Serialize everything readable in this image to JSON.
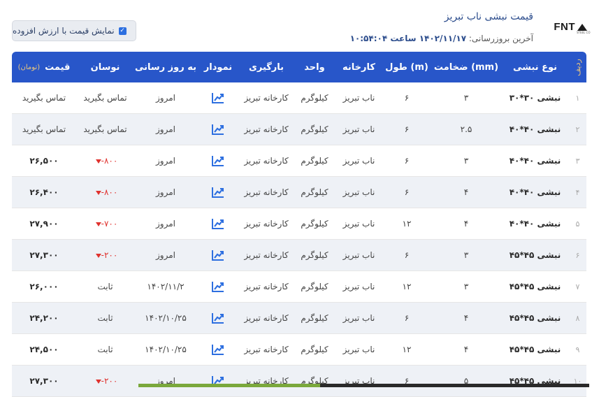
{
  "header": {
    "title": "قیمت نبشی ناب تبریز",
    "updated_label": "آخرین بروزرسانی:",
    "updated_value": "۱۴۰۲/۱۱/۱۷ ساعت ۱۰:۵۴:۰۴",
    "logo_text": "FNT",
    "logo_sub": "STEEL CO",
    "vat_label": "نمایش قیمت با ارزش افزوده",
    "vat_checked": true
  },
  "columns": {
    "radif": "ردیف",
    "type": "نوع نبشی",
    "thickness": "ضخامت (mm)",
    "length": "طول (m)",
    "factory": "کارخانه",
    "unit": "واحد",
    "loading": "بارگیری",
    "chart": "نمودار",
    "updated": "به روز رسانی",
    "fluctuation": "نوسان",
    "price": "قیمت",
    "price_unit": "(تومان)"
  },
  "rows": [
    {
      "idx": "۱",
      "type": "نبشی ۳۰*۳۰",
      "thickness": "۳",
      "length": "۶",
      "factory": "ناب تبریز",
      "unit": "کیلوگرم",
      "loading": "کارخانه تبریز",
      "updated": "امروز",
      "fluctuation": "تماس بگیرید",
      "fluc_dir": "none",
      "price": "تماس بگیرید",
      "price_bold": false
    },
    {
      "idx": "۲",
      "type": "نبشی ۴۰*۴۰",
      "thickness": "۲.۵",
      "length": "۶",
      "factory": "ناب تبریز",
      "unit": "کیلوگرم",
      "loading": "کارخانه تبریز",
      "updated": "امروز",
      "fluctuation": "تماس بگیرید",
      "fluc_dir": "none",
      "price": "تماس بگیرید",
      "price_bold": false
    },
    {
      "idx": "۳",
      "type": "نبشی ۴۰*۴۰",
      "thickness": "۳",
      "length": "۶",
      "factory": "ناب تبریز",
      "unit": "کیلوگرم",
      "loading": "کارخانه تبریز",
      "updated": "امروز",
      "fluctuation": "-۸۰۰",
      "fluc_dir": "down",
      "price": "۲۶,۵۰۰",
      "price_bold": true
    },
    {
      "idx": "۴",
      "type": "نبشی ۴۰*۴۰",
      "thickness": "۴",
      "length": "۶",
      "factory": "ناب تبریز",
      "unit": "کیلوگرم",
      "loading": "کارخانه تبریز",
      "updated": "امروز",
      "fluctuation": "-۸۰۰",
      "fluc_dir": "down",
      "price": "۲۶,۴۰۰",
      "price_bold": true
    },
    {
      "idx": "۵",
      "type": "نبشی ۴۰*۴۰",
      "thickness": "۴",
      "length": "۱۲",
      "factory": "ناب تبریز",
      "unit": "کیلوگرم",
      "loading": "کارخانه تبریز",
      "updated": "امروز",
      "fluctuation": "-۷۰۰",
      "fluc_dir": "down",
      "price": "۲۷,۹۰۰",
      "price_bold": true
    },
    {
      "idx": "۶",
      "type": "نبشی ۴۵*۴۵",
      "thickness": "۳",
      "length": "۶",
      "factory": "ناب تبریز",
      "unit": "کیلوگرم",
      "loading": "کارخانه تبریز",
      "updated": "امروز",
      "fluctuation": "-۲۰۰",
      "fluc_dir": "down",
      "price": "۲۷,۳۰۰",
      "price_bold": true
    },
    {
      "idx": "۷",
      "type": "نبشی ۴۵*۴۵",
      "thickness": "۳",
      "length": "۱۲",
      "factory": "ناب تبریز",
      "unit": "کیلوگرم",
      "loading": "کارخانه تبریز",
      "updated": "۱۴۰۲/۱۱/۲",
      "fluctuation": "ثابت",
      "fluc_dir": "none",
      "price": "۲۶,۰۰۰",
      "price_bold": true
    },
    {
      "idx": "۸",
      "type": "نبشی ۴۵*۴۵",
      "thickness": "۴",
      "length": "۶",
      "factory": "ناب تبریز",
      "unit": "کیلوگرم",
      "loading": "کارخانه تبریز",
      "updated": "۱۴۰۲/۱۰/۲۵",
      "fluctuation": "ثابت",
      "fluc_dir": "none",
      "price": "۲۴,۲۰۰",
      "price_bold": true
    },
    {
      "idx": "۹",
      "type": "نبشی ۴۵*۴۵",
      "thickness": "۴",
      "length": "۱۲",
      "factory": "ناب تبریز",
      "unit": "کیلوگرم",
      "loading": "کارخانه تبریز",
      "updated": "۱۴۰۲/۱۰/۲۵",
      "fluctuation": "ثابت",
      "fluc_dir": "none",
      "price": "۲۴,۵۰۰",
      "price_bold": true
    },
    {
      "idx": "۱۰",
      "type": "نبشی ۴۵*۴۵",
      "thickness": "۵",
      "length": "۶",
      "factory": "ناب تبریز",
      "unit": "کیلوگرم",
      "loading": "کارخانه تبریز",
      "updated": "امروز",
      "fluctuation": "-۲۰۰",
      "fluc_dir": "down",
      "price": "۲۷,۳۰۰",
      "price_bold": true
    }
  ],
  "colors": {
    "header_bg": "#2856c9",
    "accent_gold": "#f0c97a",
    "down_red": "#e0322e",
    "title_blue": "#2b4c8c"
  }
}
